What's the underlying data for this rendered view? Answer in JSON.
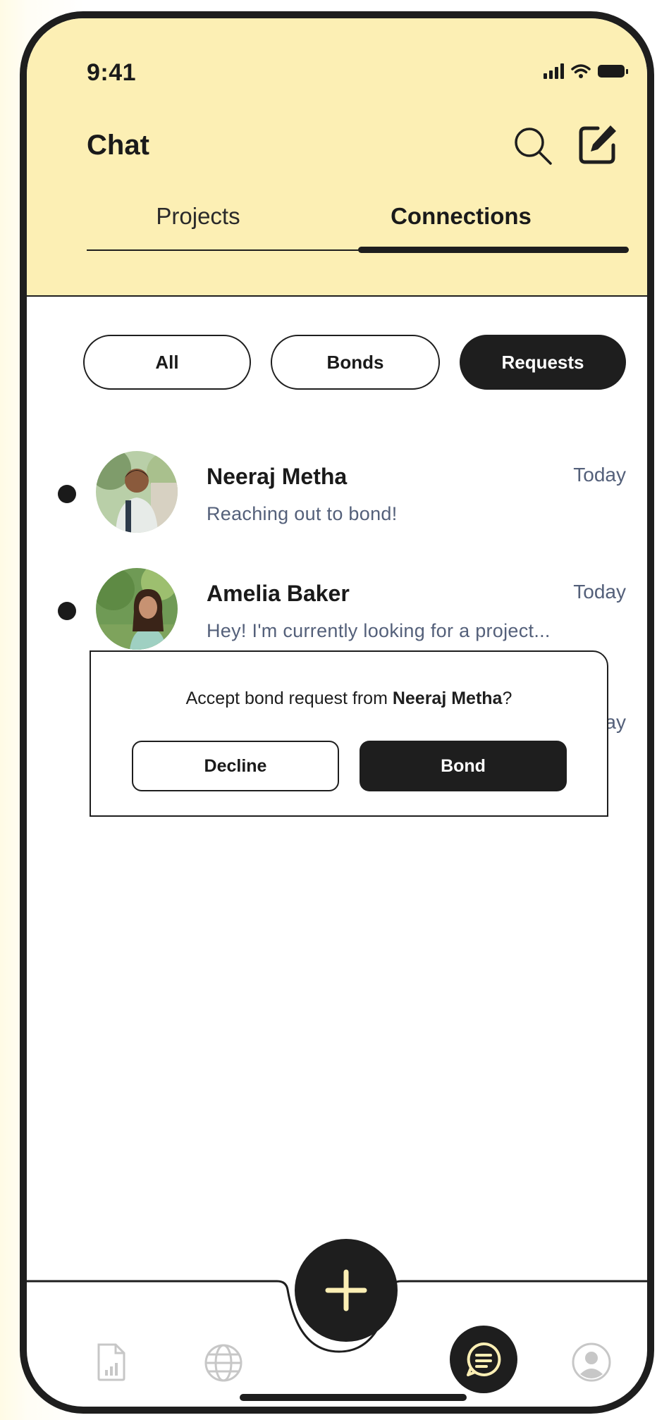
{
  "status_bar": {
    "time": "9:41"
  },
  "header": {
    "title": "Chat",
    "tabs": [
      {
        "label": "Projects",
        "active": false
      },
      {
        "label": "Connections",
        "active": true
      }
    ]
  },
  "filters": [
    {
      "label": "All",
      "selected": false
    },
    {
      "label": "Bonds",
      "selected": false
    },
    {
      "label": "Requests",
      "selected": true
    }
  ],
  "conversations": [
    {
      "name": "Neeraj Metha",
      "message": "Reaching out to bond!",
      "time": "Today",
      "unread": true
    },
    {
      "name": "Amelia Baker",
      "message": "Hey! I'm currently looking for a project...",
      "time": "Today",
      "unread": true
    }
  ],
  "obscured_time_fragment": "ay",
  "dialog": {
    "prompt_prefix": "Accept bond request from ",
    "prompt_name": "Neeraj Metha",
    "prompt_suffix": "?",
    "decline_label": "Decline",
    "bond_label": "Bond"
  },
  "bottom_nav": [
    {
      "icon": "stats-document-icon",
      "active": false
    },
    {
      "icon": "globe-icon",
      "active": false
    },
    {
      "icon": "chat-icon",
      "active": true
    },
    {
      "icon": "profile-icon",
      "active": false
    }
  ],
  "colors": {
    "header_bg": "#fcefb4",
    "dark": "#1e1e1e",
    "muted_text": "#54607a",
    "fab_plus": "#fcefb4"
  }
}
